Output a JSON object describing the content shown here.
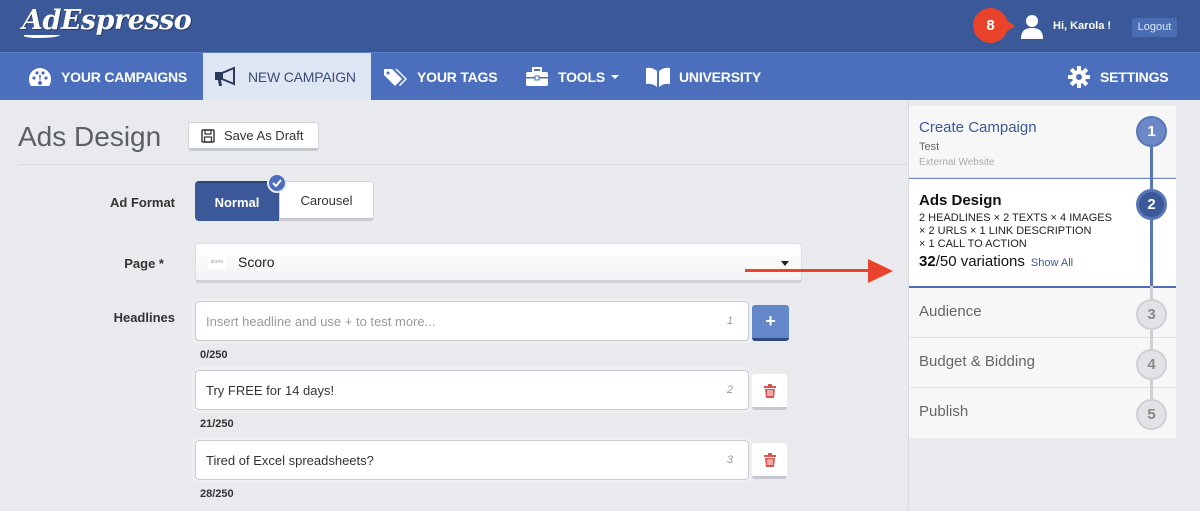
{
  "header": {
    "logo": "AdEspresso",
    "notification_count": "8",
    "greeting": "Hi, Karola !",
    "logout_label": "Logout"
  },
  "nav": {
    "items": [
      {
        "label": "YOUR CAMPAIGNS",
        "icon": "dashboard-icon",
        "active": false
      },
      {
        "label": "NEW CAMPAIGN",
        "icon": "megaphone-icon",
        "active": true
      },
      {
        "label": "YOUR TAGS",
        "icon": "tags-icon",
        "active": false
      },
      {
        "label": "TOOLS",
        "icon": "briefcase-icon",
        "active": false,
        "dropdown": true
      },
      {
        "label": "UNIVERSITY",
        "icon": "book-icon",
        "active": false
      }
    ],
    "settings_label": "SETTINGS"
  },
  "main": {
    "title": "Ads Design",
    "save_draft_label": "Save As Draft",
    "ad_format": {
      "label": "Ad Format",
      "options": [
        "Normal",
        "Carousel"
      ],
      "selected": "Normal"
    },
    "page": {
      "label": "Page *",
      "selected": "Scoro",
      "logo_text": "scoro"
    },
    "headlines": {
      "label": "Headlines",
      "placeholder": "Insert headline and use + to test more...",
      "items": [
        {
          "value": "",
          "index": "1",
          "counter": "0/250"
        },
        {
          "value": "Try FREE for 14 days!",
          "index": "2",
          "counter": "21/250"
        },
        {
          "value": "Tired of Excel spreadsheets?",
          "index": "3",
          "counter": "28/250"
        }
      ],
      "add_label": "+"
    }
  },
  "steps": {
    "items": [
      {
        "number": "1",
        "title": "Create Campaign",
        "sub": "Test",
        "sub2": "External Website",
        "state": "done"
      },
      {
        "number": "2",
        "title": "Ads Design",
        "desc": [
          "2 HEADLINES × 2 TEXTS × 4 IMAGES",
          "× 2 URLS × 1 LINK DESCRIPTION",
          "× 1 CALL TO ACTION"
        ],
        "variations_current": "32",
        "variations_rest": "/50 variations",
        "show_all": "Show All",
        "state": "current"
      },
      {
        "number": "3",
        "title": "Audience",
        "state": "todo"
      },
      {
        "number": "4",
        "title": "Budget & Bidding",
        "state": "todo"
      },
      {
        "number": "5",
        "title": "Publish",
        "state": "todo"
      }
    ]
  },
  "colors": {
    "brand": "#3b5998",
    "nav": "#4b6fbc",
    "accent_red": "#e9432c"
  }
}
